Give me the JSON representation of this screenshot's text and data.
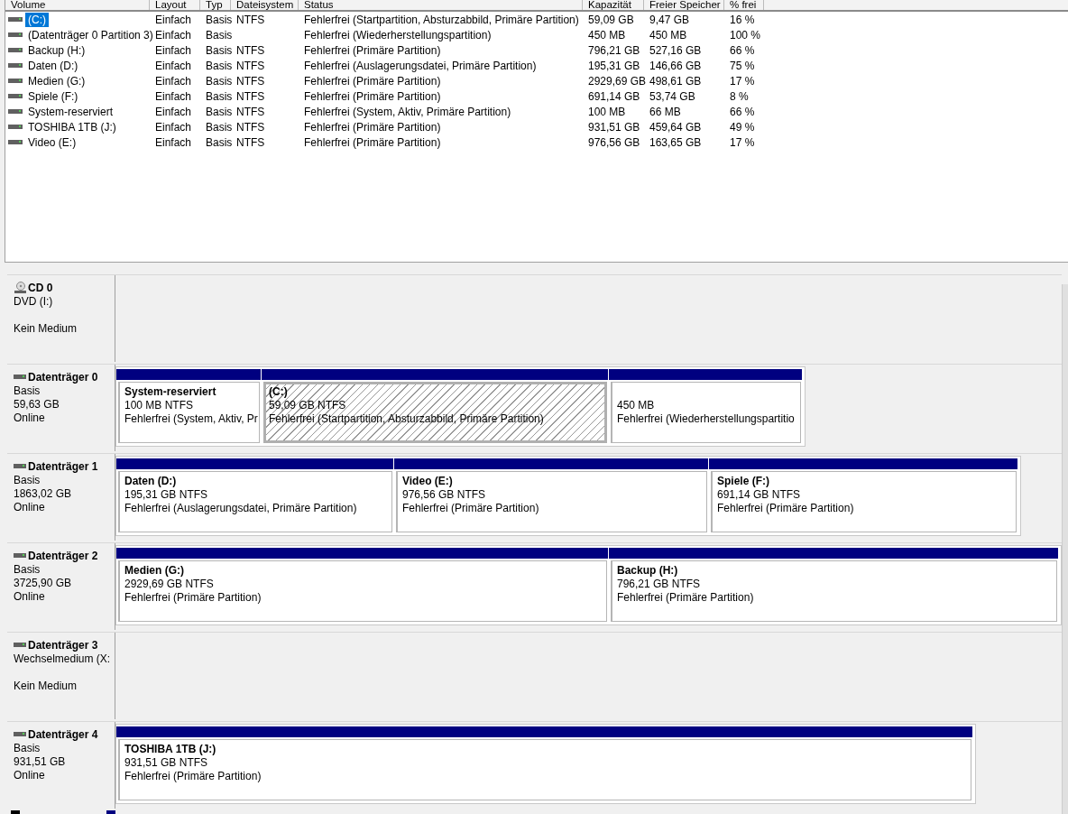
{
  "volume_table": {
    "columns": [
      "Volume",
      "Layout",
      "Typ",
      "Dateisystem",
      "Status",
      "Kapazität",
      "Freier Speicher",
      "% frei"
    ],
    "rows": [
      {
        "volume": "(C:)",
        "layout": "Einfach",
        "type": "Basis",
        "filesystem": "NTFS",
        "status": "Fehlerfrei (Startpartition, Absturzabbild, Primäre Partition)",
        "capacity": "59,09 GB",
        "free": "9,47 GB",
        "percent_free": "16 %",
        "selected": true
      },
      {
        "volume": "(Datenträger 0 Partition 3)",
        "layout": "Einfach",
        "type": "Basis",
        "status": "Fehlerfrei (Wiederherstellungspartition)",
        "capacity": "450 MB",
        "free": "450 MB",
        "percent_free": "100 %",
        "selected": false
      },
      {
        "volume": "Backup (H:)",
        "layout": "Einfach",
        "type": "Basis",
        "filesystem": "NTFS",
        "status": "Fehlerfrei (Primäre Partition)",
        "capacity": "796,21 GB",
        "free": "527,16 GB",
        "percent_free": "66 %",
        "selected": false
      },
      {
        "volume": "Daten (D:)",
        "layout": "Einfach",
        "type": "Basis",
        "filesystem": "NTFS",
        "status": "Fehlerfrei (Auslagerungsdatei, Primäre Partition)",
        "capacity": "195,31 GB",
        "free": "146,66 GB",
        "percent_free": "75 %",
        "selected": false
      },
      {
        "volume": "Medien (G:)",
        "layout": "Einfach",
        "type": "Basis",
        "filesystem": "NTFS",
        "status": "Fehlerfrei (Primäre Partition)",
        "capacity": "2929,69 GB",
        "free": "498,61 GB",
        "percent_free": "17 %",
        "selected": false
      },
      {
        "volume": "Spiele (F:)",
        "layout": "Einfach",
        "type": "Basis",
        "filesystem": "NTFS",
        "status": "Fehlerfrei (Primäre Partition)",
        "capacity": "691,14 GB",
        "free": "53,74 GB",
        "percent_free": "8 %",
        "selected": false
      },
      {
        "volume": "System-reserviert",
        "layout": "Einfach",
        "type": "Basis",
        "filesystem": "NTFS",
        "status": "Fehlerfrei (System, Aktiv, Primäre Partition)",
        "capacity": "100 MB",
        "free": "66 MB",
        "percent_free": "66 %",
        "selected": false
      },
      {
        "volume": "TOSHIBA 1TB (J:)",
        "layout": "Einfach",
        "type": "Basis",
        "filesystem": "NTFS",
        "status": "Fehlerfrei (Primäre Partition)",
        "capacity": "931,51 GB",
        "free": "459,64 GB",
        "percent_free": "49 %",
        "selected": false
      },
      {
        "volume": "Video (E:)",
        "layout": "Einfach",
        "type": "Basis",
        "filesystem": "NTFS",
        "status": "Fehlerfrei (Primäre Partition)",
        "capacity": "976,56 GB",
        "free": "163,65 GB",
        "percent_free": "17 %",
        "selected": false
      }
    ]
  },
  "disks": [
    {
      "kind": "optical",
      "name": "CD 0",
      "info": [
        "DVD (I:)"
      ],
      "note": "Kein Medium"
    },
    {
      "kind": "hard",
      "name": "Datenträger 0",
      "info": [
        "Basis",
        "59,63 GB",
        "Online"
      ],
      "partitions": [
        {
          "name": "System-reserviert",
          "size": "100 MB NTFS",
          "status": "Fehlerfrei (System, Aktiv, Pr",
          "selected": false
        },
        {
          "name": "(C:)",
          "size": "59,09 GB NTFS",
          "status": "Fehlerfrei (Startpartition, Absturzabbild, Primäre Partition)",
          "selected": true
        },
        {
          "size": "450 MB",
          "status": "Fehlerfrei (Wiederherstellungspartitio",
          "selected": false
        }
      ]
    },
    {
      "kind": "hard",
      "name": "Datenträger 1",
      "info": [
        "Basis",
        "1863,02 GB",
        "Online"
      ],
      "partitions": [
        {
          "name": "Daten  (D:)",
          "size": "195,31 GB NTFS",
          "status": "Fehlerfrei (Auslagerungsdatei, Primäre Partition)",
          "selected": false
        },
        {
          "name": "Video  (E:)",
          "size": "976,56 GB NTFS",
          "status": "Fehlerfrei (Primäre Partition)",
          "selected": false
        },
        {
          "name": "Spiele  (F:)",
          "size": "691,14 GB NTFS",
          "status": "Fehlerfrei (Primäre Partition)",
          "selected": false
        }
      ]
    },
    {
      "kind": "hard",
      "name": "Datenträger 2",
      "info": [
        "Basis",
        "3725,90 GB",
        "Online"
      ],
      "partitions": [
        {
          "name": "Medien  (G:)",
          "size": "2929,69 GB NTFS",
          "status": "Fehlerfrei (Primäre Partition)",
          "selected": false
        },
        {
          "name": "Backup  (H:)",
          "size": "796,21 GB NTFS",
          "status": "Fehlerfrei (Primäre Partition)",
          "selected": false
        }
      ]
    },
    {
      "kind": "hard",
      "name": "Datenträger 3",
      "info": [
        "Wechselmedium (X:"
      ],
      "note": "Kein Medium"
    },
    {
      "kind": "hard",
      "name": "Datenträger 4",
      "info": [
        "Basis",
        "931,51 GB",
        "Online"
      ],
      "partitions": [
        {
          "name": "TOSHIBA 1TB  (J:)",
          "size": "931,51 GB NTFS",
          "status": "Fehlerfrei (Primäre Partition)",
          "selected": false
        }
      ]
    }
  ],
  "legend": [
    {
      "color": "#000000"
    },
    {
      "color": "#000080"
    }
  ]
}
